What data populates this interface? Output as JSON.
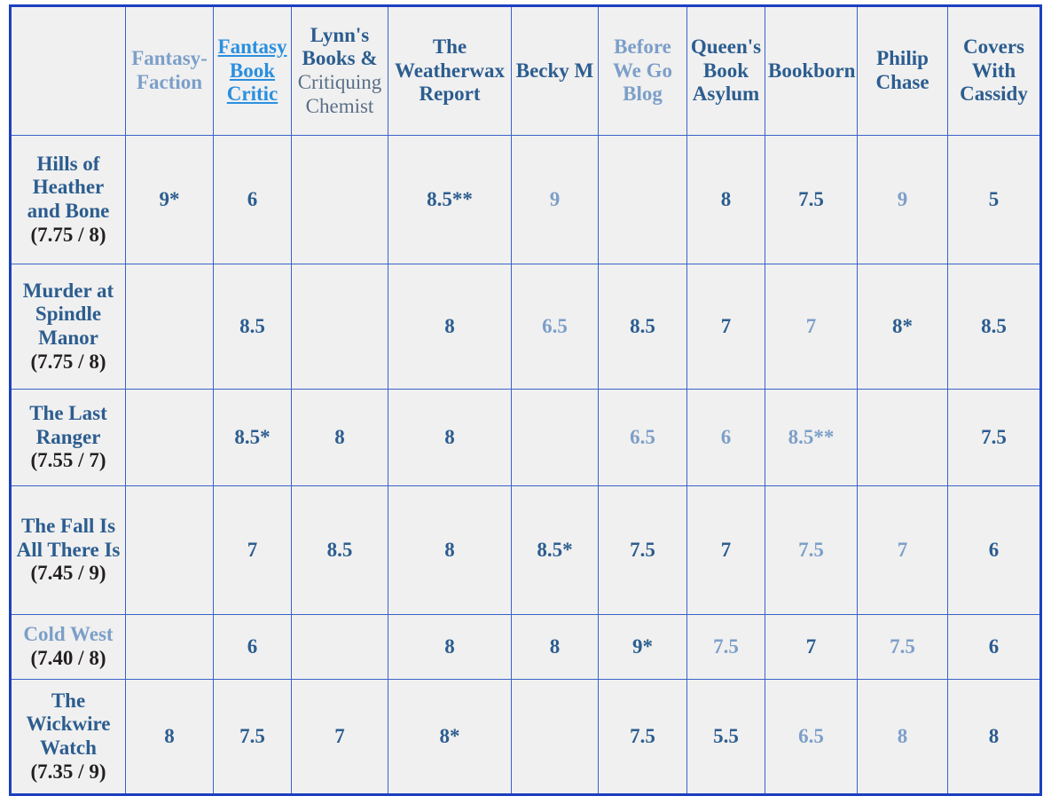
{
  "table": {
    "corner_label": "",
    "columns": [
      {
        "id": "fantasy-faction",
        "label": "Fantasy-Faction",
        "style": "light",
        "link": false
      },
      {
        "id": "fantasy-book-critic",
        "label": "Fantasy Book Critic",
        "style": "link",
        "link": true
      },
      {
        "id": "lynns-books",
        "label": "Lynn's Books &",
        "sub": "Critiquing Chemist",
        "style": "dark",
        "link": false
      },
      {
        "id": "weatherwax-report",
        "label": "The Weatherwax Report",
        "style": "dark",
        "link": false
      },
      {
        "id": "becky-m",
        "label": "Becky M",
        "style": "dark",
        "link": false
      },
      {
        "id": "before-we-go-blog",
        "label": "Before We Go Blog",
        "style": "light",
        "link": false
      },
      {
        "id": "queens-book-asylum",
        "label": "Queen's Book Asylum",
        "style": "dark",
        "link": false
      },
      {
        "id": "bookborn",
        "label": "Bookborn",
        "style": "dark",
        "link": false
      },
      {
        "id": "philip-chase",
        "label": "Philip Chase",
        "style": "dark",
        "link": false
      },
      {
        "id": "covers-with-cassidy",
        "label": "Covers With Cassidy",
        "style": "dark",
        "link": false
      }
    ],
    "rows": [
      {
        "title": "Hills of Heather and Bone",
        "score": "(7.75 / 8)",
        "title_style": "dark",
        "cells": [
          {
            "value": "9*",
            "style": "dark"
          },
          {
            "value": "6",
            "style": "dark"
          },
          {
            "value": "",
            "style": "empty"
          },
          {
            "value": "8.5**",
            "style": "dark"
          },
          {
            "value": "9",
            "style": "light"
          },
          {
            "value": "",
            "style": "empty"
          },
          {
            "value": "8",
            "style": "dark"
          },
          {
            "value": "7.5",
            "style": "dark"
          },
          {
            "value": "9",
            "style": "light"
          },
          {
            "value": "5",
            "style": "dark"
          }
        ]
      },
      {
        "title": "Murder at Spindle Manor",
        "score": "(7.75 / 8)",
        "title_style": "dark",
        "cells": [
          {
            "value": "",
            "style": "empty"
          },
          {
            "value": "8.5",
            "style": "dark"
          },
          {
            "value": "",
            "style": "empty"
          },
          {
            "value": "8",
            "style": "dark"
          },
          {
            "value": "6.5",
            "style": "light"
          },
          {
            "value": "8.5",
            "style": "dark"
          },
          {
            "value": "7",
            "style": "dark"
          },
          {
            "value": "7",
            "style": "light"
          },
          {
            "value": "8*",
            "style": "dark"
          },
          {
            "value": "8.5",
            "style": "dark"
          }
        ]
      },
      {
        "title": "The Last Ranger",
        "score": "(7.55 / 7)",
        "title_style": "dark",
        "cells": [
          {
            "value": "",
            "style": "empty"
          },
          {
            "value": "8.5*",
            "style": "dark"
          },
          {
            "value": "8",
            "style": "dark"
          },
          {
            "value": "8",
            "style": "dark"
          },
          {
            "value": "",
            "style": "empty"
          },
          {
            "value": "6.5",
            "style": "light"
          },
          {
            "value": "6",
            "style": "light"
          },
          {
            "value": "8.5**",
            "style": "light"
          },
          {
            "value": "",
            "style": "empty"
          },
          {
            "value": "7.5",
            "style": "dark"
          }
        ]
      },
      {
        "title": "The Fall Is All There Is",
        "score": "(7.45 / 9)",
        "title_style": "dark",
        "cells": [
          {
            "value": "",
            "style": "empty"
          },
          {
            "value": "7",
            "style": "dark"
          },
          {
            "value": "8.5",
            "style": "dark"
          },
          {
            "value": "8",
            "style": "dark"
          },
          {
            "value": "8.5*",
            "style": "dark"
          },
          {
            "value": "7.5",
            "style": "dark"
          },
          {
            "value": "7",
            "style": "dark"
          },
          {
            "value": "7.5",
            "style": "light"
          },
          {
            "value": "7",
            "style": "light"
          },
          {
            "value": "6",
            "style": "dark"
          }
        ]
      },
      {
        "title": "Cold West",
        "score": "(7.40 / 8)",
        "title_style": "light",
        "cells": [
          {
            "value": "",
            "style": "empty"
          },
          {
            "value": "6",
            "style": "dark"
          },
          {
            "value": "",
            "style": "empty"
          },
          {
            "value": "8",
            "style": "dark"
          },
          {
            "value": "8",
            "style": "dark"
          },
          {
            "value": "9*",
            "style": "dark"
          },
          {
            "value": "7.5",
            "style": "light"
          },
          {
            "value": "7",
            "style": "dark"
          },
          {
            "value": "7.5",
            "style": "light"
          },
          {
            "value": "6",
            "style": "dark"
          }
        ]
      },
      {
        "title": "The Wickwire Watch",
        "score": "(7.35 / 9)",
        "title_style": "dark",
        "cells": [
          {
            "value": "8",
            "style": "dark"
          },
          {
            "value": "7.5",
            "style": "dark"
          },
          {
            "value": "7",
            "style": "dark"
          },
          {
            "value": "8*",
            "style": "dark"
          },
          {
            "value": "",
            "style": "empty"
          },
          {
            "value": "7.5",
            "style": "dark"
          },
          {
            "value": "5.5",
            "style": "dark"
          },
          {
            "value": "6.5",
            "style": "light"
          },
          {
            "value": "8",
            "style": "light"
          },
          {
            "value": "8",
            "style": "dark"
          }
        ]
      }
    ]
  },
  "colors": {
    "border_outer": "#1c3fc0",
    "border_inner": "#3a63c8",
    "cell_bg": "#f0f0f0",
    "text_dark_blue": "#2c5d8f",
    "text_light_blue": "#7c9fc9",
    "link_blue": "#2a8fdf",
    "score_black": "#231f20"
  }
}
